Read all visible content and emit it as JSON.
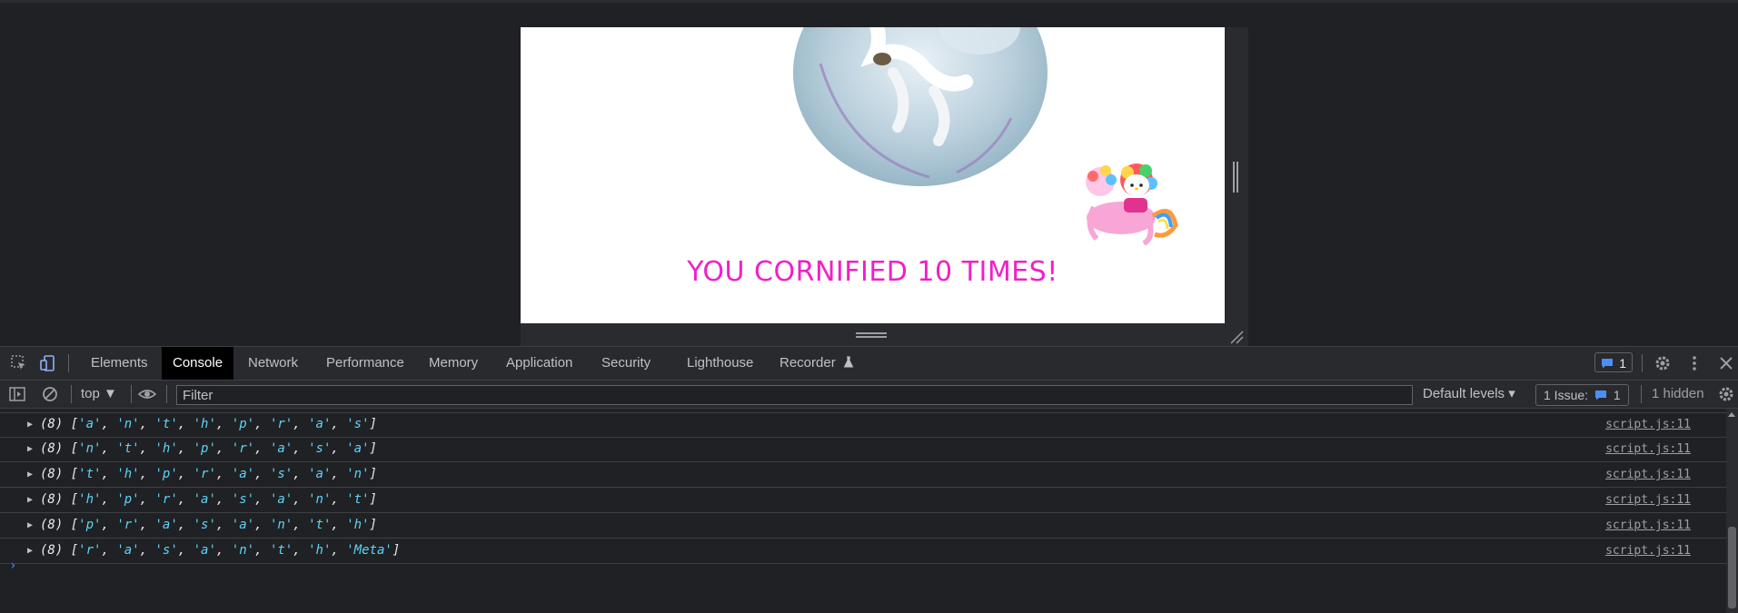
{
  "page": {
    "banner_text": "YOU CORNIFIED 10 TIMES!"
  },
  "devtools": {
    "tabs": [
      "Elements",
      "Console",
      "Network",
      "Performance",
      "Memory",
      "Application",
      "Security",
      "Lighthouse",
      "Recorder"
    ],
    "active_tab": "Console",
    "message_badge_count": "1",
    "toolbar": {
      "context": "top ▼",
      "filter_placeholder": "Filter",
      "levels": "Default levels ▾",
      "issues_label": "1 Issue:",
      "issues_count": "1",
      "hidden": "1 hidden"
    },
    "console_rows": [
      {
        "count": "(8) ",
        "items": [
          "'a'",
          "'n'",
          "'t'",
          "'h'",
          "'p'",
          "'r'",
          "'a'",
          "'s'"
        ],
        "source": "script.js:11"
      },
      {
        "count": "(8) ",
        "items": [
          "'n'",
          "'t'",
          "'h'",
          "'p'",
          "'r'",
          "'a'",
          "'s'",
          "'a'"
        ],
        "source": "script.js:11"
      },
      {
        "count": "(8) ",
        "items": [
          "'t'",
          "'h'",
          "'p'",
          "'r'",
          "'a'",
          "'s'",
          "'a'",
          "'n'"
        ],
        "source": "script.js:11"
      },
      {
        "count": "(8) ",
        "items": [
          "'h'",
          "'p'",
          "'r'",
          "'a'",
          "'s'",
          "'a'",
          "'n'",
          "'t'"
        ],
        "source": "script.js:11"
      },
      {
        "count": "(8) ",
        "items": [
          "'p'",
          "'r'",
          "'a'",
          "'s'",
          "'a'",
          "'n'",
          "'t'",
          "'h'"
        ],
        "source": "script.js:11"
      },
      {
        "count": "(8) ",
        "items": [
          "'r'",
          "'a'",
          "'s'",
          "'a'",
          "'n'",
          "'t'",
          "'h'",
          "'Meta'"
        ],
        "source": "script.js:11"
      }
    ]
  },
  "colors": {
    "banner": "#f020c8",
    "string_value": "#5cd5fb",
    "accent_blue": "#4a8ff7"
  }
}
